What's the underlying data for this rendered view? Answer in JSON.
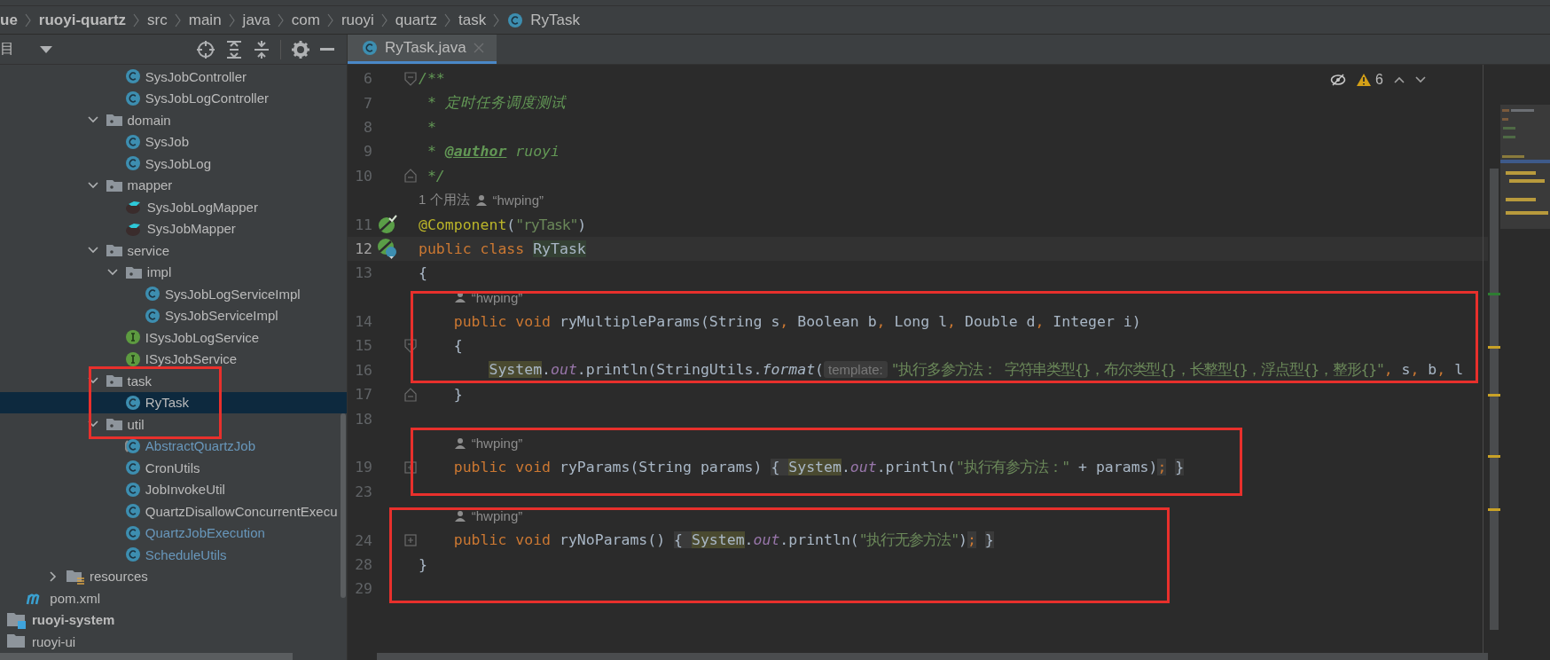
{
  "breadcrumb": [
    {
      "label": "ue",
      "kind": "module"
    },
    {
      "label": "ruoyi-quartz",
      "kind": "module"
    },
    {
      "label": "src",
      "kind": "folder"
    },
    {
      "label": "main",
      "kind": "folder"
    },
    {
      "label": "java",
      "kind": "folder"
    },
    {
      "label": "com",
      "kind": "folder"
    },
    {
      "label": "ruoyi",
      "kind": "folder"
    },
    {
      "label": "quartz",
      "kind": "folder"
    },
    {
      "label": "task",
      "kind": "folder"
    },
    {
      "label": "RyTask",
      "kind": "class"
    }
  ],
  "project_panel": {
    "title": "目",
    "tree": [
      {
        "children": [
          {
            "children": [
              {
                "children": [
                  {
                    "children": [
                      {
                        "children": [
                          {
                            "children": [
                              {
                                "label": "SysJobController",
                                "kind": "class",
                                "modified": false,
                                "selected": false
                              },
                              {
                                "label": "SysJobLogController",
                                "kind": "class",
                                "modified": false,
                                "selected": false
                              }
                            ]
                          },
                          {
                            "label": "domain",
                            "kind": "folder",
                            "expanded": true,
                            "selected": false,
                            "children": [
                              {
                                "label": "SysJob",
                                "kind": "class",
                                "modified": false,
                                "selected": false
                              },
                              {
                                "label": "SysJobLog",
                                "kind": "class",
                                "modified": false,
                                "selected": false
                              }
                            ]
                          },
                          {
                            "label": "mapper",
                            "kind": "folder",
                            "expanded": true,
                            "selected": false,
                            "children": [
                              {
                                "label": "SysJobLogMapper",
                                "kind": "mapper",
                                "modified": false,
                                "selected": false
                              },
                              {
                                "label": "SysJobMapper",
                                "kind": "mapper",
                                "modified": false,
                                "selected": false
                              }
                            ]
                          },
                          {
                            "label": "service",
                            "kind": "folder",
                            "expanded": true,
                            "selected": false,
                            "children": [
                              {
                                "label": "impl",
                                "kind": "folder",
                                "expanded": true,
                                "selected": false,
                                "children": [
                                  {
                                    "label": "SysJobLogServiceImpl",
                                    "kind": "class",
                                    "modified": false,
                                    "selected": false
                                  },
                                  {
                                    "label": "SysJobServiceImpl",
                                    "kind": "class",
                                    "modified": false,
                                    "selected": false
                                  }
                                ]
                              },
                              {
                                "label": "ISysJobLogService",
                                "kind": "interface",
                                "modified": false,
                                "selected": false
                              },
                              {
                                "label": "ISysJobService",
                                "kind": "interface",
                                "modified": false,
                                "selected": false
                              }
                            ]
                          },
                          {
                            "label": "task",
                            "kind": "folder",
                            "expanded": true,
                            "selected": false,
                            "children": [
                              {
                                "label": "RyTask",
                                "kind": "class",
                                "modified": false,
                                "selected": true
                              }
                            ]
                          },
                          {
                            "label": "util",
                            "kind": "folder",
                            "expanded": true,
                            "selected": false,
                            "children": [
                              {
                                "label": "AbstractQuartzJob",
                                "kind": "abstract_class",
                                "modified": true,
                                "selected": false
                              },
                              {
                                "label": "CronUtils",
                                "kind": "class",
                                "modified": false,
                                "selected": false
                              },
                              {
                                "label": "JobInvokeUtil",
                                "kind": "class",
                                "modified": false,
                                "selected": false
                              },
                              {
                                "label": "QuartzDisallowConcurrentExecu",
                                "kind": "class",
                                "modified": false,
                                "selected": false
                              },
                              {
                                "label": "QuartzJobExecution",
                                "kind": "class",
                                "modified": true,
                                "selected": false
                              },
                              {
                                "label": "ScheduleUtils",
                                "kind": "class",
                                "modified": true,
                                "selected": false
                              }
                            ]
                          }
                        ]
                      }
                    ]
                  },
                  {
                    "label": "resources",
                    "kind": "resources",
                    "expanded": false,
                    "selected": false
                  }
                ]
              }
            ]
          },
          {
            "label": "pom.xml",
            "kind": "maven",
            "modified": false,
            "selected": false
          }
        ]
      },
      {
        "label": "ruoyi-system",
        "kind": "module",
        "loaded": true,
        "selected": false
      },
      {
        "label": "ruoyi-ui",
        "kind": "module",
        "loaded": false,
        "selected": false
      }
    ]
  },
  "editor": {
    "tabs": [
      {
        "label": "RyTask.java",
        "selected": true
      }
    ],
    "warnings": "6",
    "lines": [
      {
        "kind": "code",
        "number": "6",
        "fold": {
          "kind": "start"
        },
        "current": false,
        "tokens": [
          {
            "kind": "comment",
            "text": "/**"
          }
        ]
      },
      {
        "kind": "code",
        "number": "7",
        "current": false,
        "tokens": [
          {
            "kind": "comment",
            "text": " * 定时任务调度测试"
          }
        ]
      },
      {
        "kind": "code",
        "number": "8",
        "current": false,
        "tokens": [
          {
            "kind": "comment",
            "text": " *"
          }
        ]
      },
      {
        "kind": "code",
        "number": "9",
        "current": false,
        "tokens": [
          {
            "kind": "comment",
            "text": " * "
          },
          {
            "kind": "doctag",
            "text": "@author"
          },
          {
            "kind": "comment",
            "text": " ruoyi"
          }
        ]
      },
      {
        "kind": "code",
        "number": "10",
        "fold": {
          "kind": "end"
        },
        "current": false,
        "tokens": [
          {
            "kind": "comment",
            "text": " */"
          }
        ]
      },
      {
        "kind": "hint",
        "usages": "1 个用法",
        "author": "“hwping”"
      },
      {
        "kind": "code",
        "number": "11",
        "gutter": {
          "kind": "bean"
        },
        "current": false,
        "tokens": [
          {
            "kind": "annot",
            "text": "@Component"
          },
          {
            "kind": "plain",
            "text": "("
          },
          {
            "kind": "str",
            "text": "\"ryTask\""
          },
          {
            "kind": "plain",
            "text": ")"
          }
        ]
      },
      {
        "kind": "code",
        "number": "12",
        "gutter": {
          "kind": "bean_class"
        },
        "current": true,
        "tokens": [
          {
            "kind": "kw",
            "text": "public class "
          },
          {
            "kind": "decl",
            "text": "RyTask"
          }
        ]
      },
      {
        "kind": "code",
        "number": "13",
        "current": false,
        "tokens": [
          {
            "kind": "plain",
            "text": "{"
          }
        ]
      },
      {
        "kind": "hint",
        "author": "“hwping”"
      },
      {
        "kind": "code",
        "number": "14",
        "current": false,
        "tokens": [
          {
            "kind": "kw",
            "text": "    public void "
          },
          {
            "kind": "plain",
            "text": "ryMultipleParams(String s"
          },
          {
            "kind": "punct",
            "text": ", "
          },
          {
            "kind": "plain",
            "text": "Boolean b"
          },
          {
            "kind": "punct",
            "text": ", "
          },
          {
            "kind": "plain",
            "text": "Long l"
          },
          {
            "kind": "punct",
            "text": ", "
          },
          {
            "kind": "plain",
            "text": "Double d"
          },
          {
            "kind": "punct",
            "text": ", "
          },
          {
            "kind": "plain",
            "text": "Integer i)"
          }
        ]
      },
      {
        "kind": "code",
        "number": "15",
        "fold": {
          "kind": "start"
        },
        "current": false,
        "tokens": [
          {
            "kind": "plain",
            "text": "    {"
          }
        ]
      },
      {
        "kind": "code",
        "number": "16",
        "current": false,
        "tokens": [
          {
            "kind": "sys",
            "text": "        System"
          },
          {
            "kind": "plain",
            "text": "."
          },
          {
            "kind": "field",
            "text": "out"
          },
          {
            "kind": "plain",
            "text": ".println(StringUtils."
          },
          {
            "kind": "method",
            "text": "format"
          },
          {
            "kind": "plain",
            "text": "("
          },
          {
            "kind": "param_hint",
            "text": "template:"
          },
          {
            "kind": "str",
            "text": "\"执行多参方法： 字符串类型{}，布尔类型{}，长整型{}，浮点型{}，整形{}\""
          },
          {
            "kind": "punct",
            "text": ", "
          },
          {
            "kind": "plain",
            "text": "s"
          },
          {
            "kind": "punct",
            "text": ", "
          },
          {
            "kind": "plain",
            "text": "b"
          },
          {
            "kind": "punct",
            "text": ", "
          },
          {
            "kind": "plain",
            "text": "l"
          }
        ]
      },
      {
        "kind": "code",
        "number": "17",
        "fold": {
          "kind": "end"
        },
        "current": false,
        "tokens": [
          {
            "kind": "plain",
            "text": "    }"
          }
        ]
      },
      {
        "kind": "code",
        "number": "18",
        "current": false
      },
      {
        "kind": "hint",
        "author": "“hwping”"
      },
      {
        "kind": "code",
        "number": "19",
        "fold": {
          "kind": "collapsed"
        },
        "current": false,
        "tokens": [
          {
            "kind": "kw",
            "text": "    public void "
          },
          {
            "kind": "plain",
            "text": "ryParams(String params) "
          },
          {
            "kind": "fold",
            "text": "{ "
          },
          {
            "kind": "sys",
            "text": "System"
          },
          {
            "kind": "plain",
            "text": "."
          },
          {
            "kind": "field",
            "text": "out"
          },
          {
            "kind": "plain",
            "text": ".println("
          },
          {
            "kind": "str",
            "text": "\"执行有参方法：\""
          },
          {
            "kind": "plain",
            "text": " + params)"
          },
          {
            "kind": "foldpunct",
            "text": ";"
          },
          {
            "kind": "fold",
            "text": " }"
          }
        ]
      },
      {
        "kind": "code",
        "number": "23",
        "current": false
      },
      {
        "kind": "hint",
        "author": "“hwping”"
      },
      {
        "kind": "code",
        "number": "24",
        "fold": {
          "kind": "collapsed"
        },
        "current": false,
        "tokens": [
          {
            "kind": "kw",
            "text": "    public void "
          },
          {
            "kind": "plain",
            "text": "ryNoParams() "
          },
          {
            "kind": "fold",
            "text": "{ "
          },
          {
            "kind": "sys",
            "text": "System"
          },
          {
            "kind": "plain",
            "text": "."
          },
          {
            "kind": "field",
            "text": "out"
          },
          {
            "kind": "plain",
            "text": ".println("
          },
          {
            "kind": "str",
            "text": "\"执行无参方法\""
          },
          {
            "kind": "plain",
            "text": ")"
          },
          {
            "kind": "foldpunct",
            "text": ";"
          },
          {
            "kind": "fold",
            "text": " }"
          }
        ]
      },
      {
        "kind": "code",
        "number": "28",
        "current": false,
        "tokens": [
          {
            "kind": "plain",
            "text": "}"
          }
        ]
      },
      {
        "kind": "code",
        "number": "29",
        "current": false
      }
    ]
  }
}
